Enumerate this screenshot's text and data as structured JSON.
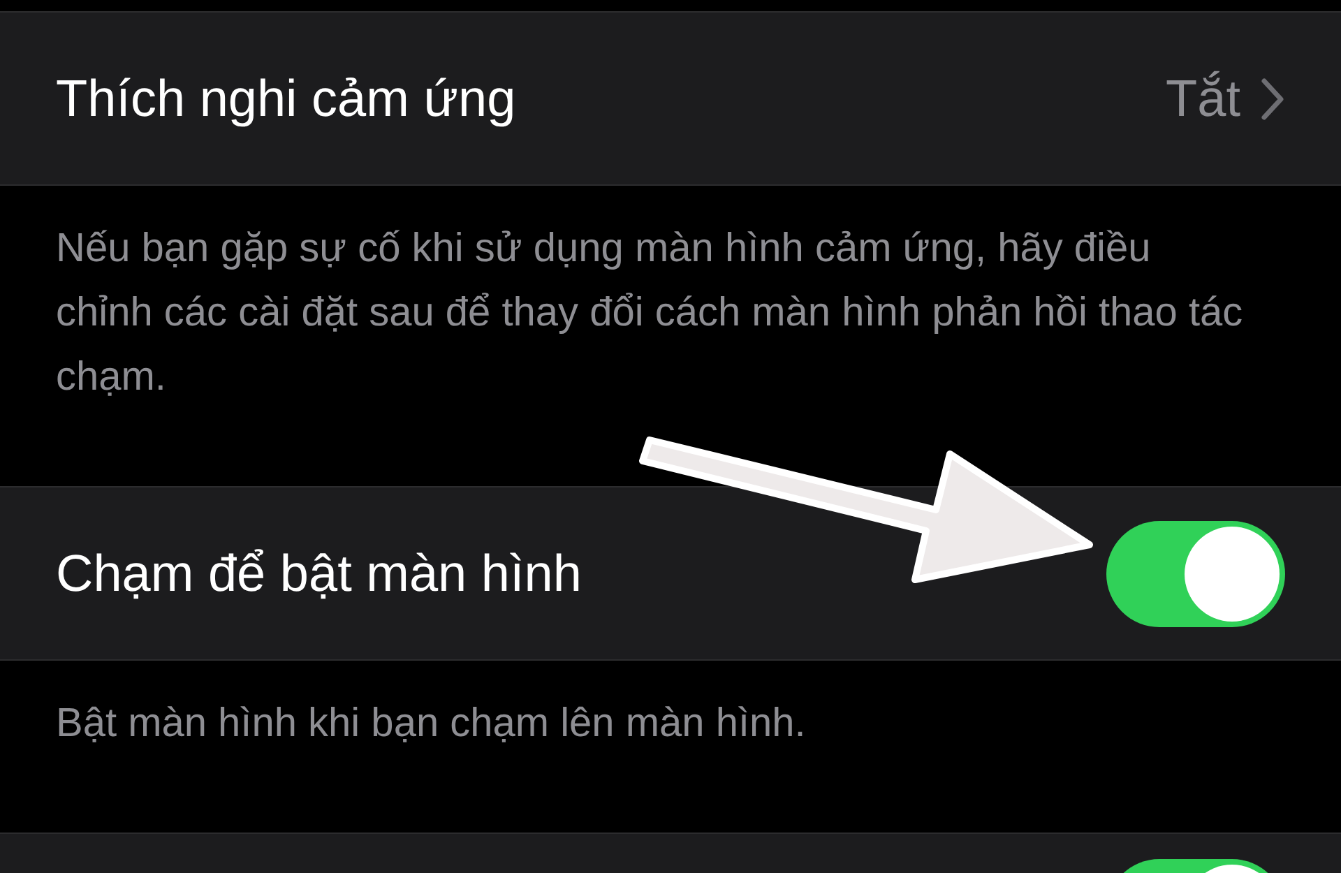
{
  "sections": [
    {
      "kind": "link",
      "label": "Thích nghi cảm ứng",
      "value": "Tắt",
      "footer": "Nếu bạn gặp sự cố khi sử dụng màn hình cảm ứng, hãy điều chỉnh các cài đặt sau để thay đổi cách màn hình phản hồi thao tác chạm."
    },
    {
      "kind": "toggle",
      "label": "Chạm để bật màn hình",
      "on": true,
      "footer": "Bật màn hình khi bạn chạm lên màn hình."
    },
    {
      "kind": "toggle",
      "on": true
    }
  ]
}
